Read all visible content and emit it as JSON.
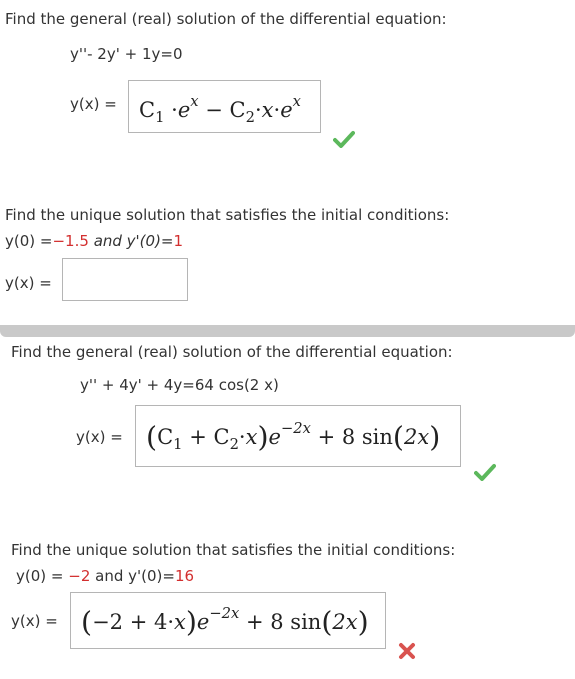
{
  "problem1": {
    "prompt": "Find the general (real) solution of the differential equation:",
    "equation": "y''- 2y' + 1y=0",
    "y_label": "y(x) =",
    "answer": {
      "c1": "C",
      "c1_sub": "1",
      "dot1": "·",
      "e1": "e",
      "e1_exp": "x",
      "minus": "−",
      "c2": "C",
      "c2_sub": "2",
      "dot2": "·",
      "x": "x",
      "dot3": "·",
      "e2": "e",
      "e2_exp": "x"
    },
    "status": "check-icon"
  },
  "problem1_ic": {
    "prompt": "Find the unique solution that satisfies the initial conditions:",
    "y0_label": "y(0) =",
    "y0_value": "−1.5",
    "and": "and y'(0)=",
    "yp0_value": "1",
    "y_label": "y(x) =",
    "answer_value": ""
  },
  "problem2": {
    "prompt": "Find the general (real) solution of the differential equation:",
    "equation": "y'' + 4y' + 4y=64 cos(2 x)",
    "y_label": "y(x) =",
    "answer": {
      "lp": "(",
      "c1": "C",
      "c1_sub": "1",
      "plus1": "+",
      "c2": "C",
      "c2_sub": "2",
      "dot": "·",
      "x": "x",
      "rp": ")",
      "e": "e",
      "e_exp": "−2x",
      "plus2": "+ 8 sin",
      "arg_lp": "(",
      "arg": "2x",
      "arg_rp": ")"
    },
    "status": "check-icon"
  },
  "problem2_ic": {
    "prompt": "Find the unique solution that satisfies the initial conditions:",
    "y0_label": "y(0) =",
    "y0_value": "−2",
    "and": "and y'(0)=",
    "yp0_value": "16",
    "y_label": "y(x) =",
    "answer": {
      "lp": "(",
      "a": "−2 + 4",
      "dot": "·",
      "x": "x",
      "rp": ")",
      "e": "e",
      "e_exp": "−2x",
      "plus": "+ 8 sin",
      "arg_lp": "(",
      "arg": "2x",
      "arg_rp": ")"
    },
    "status": "cross-icon"
  },
  "colors": {
    "correct": "#5cb85c",
    "incorrect": "#d9534f",
    "given_values": "#d32f2f"
  }
}
